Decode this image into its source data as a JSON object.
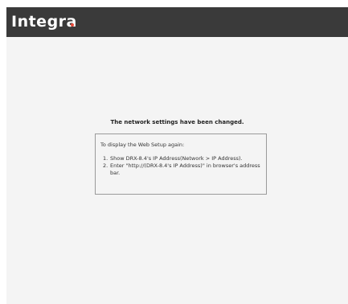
{
  "header": {
    "logo_text": "Integra",
    "logo_dot_color": "#e84a3a",
    "background_color": "#3a3a3a"
  },
  "main": {
    "message": "The network settings have been changed.",
    "info": {
      "intro": "To display the Web Setup again:",
      "steps": [
        {
          "number": "1.",
          "text": "Show DRX-8.4's IP Address(Network > IP Address)."
        },
        {
          "number": "2.",
          "text": "Enter \"http://(DRX-8.4's IP Address)\" in browser's address bar."
        }
      ]
    }
  }
}
